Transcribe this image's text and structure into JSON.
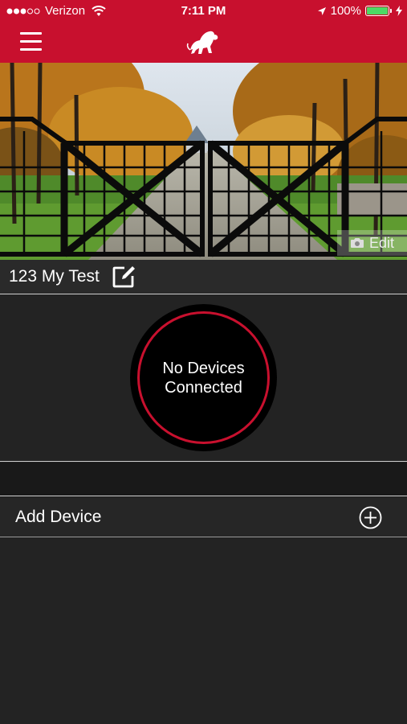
{
  "status_bar": {
    "carrier": "Verizon",
    "time": "7:11 PM",
    "battery": "100%",
    "signal_bars": 3,
    "signal_total": 5
  },
  "header": {
    "menu_icon": "hamburger-menu-icon",
    "logo_icon": "lion-logo-icon"
  },
  "hero": {
    "edit_label": "Edit",
    "edit_icon": "camera-icon"
  },
  "location": {
    "name": "123 My Test",
    "edit_icon": "edit-note-icon"
  },
  "device_status": {
    "text": "No Devices Connected"
  },
  "add_device": {
    "label": "Add Device",
    "icon": "plus-circle-icon"
  },
  "colors": {
    "brand_red": "#c8102e",
    "background": "#232323",
    "divider": "#cfcfcf"
  }
}
